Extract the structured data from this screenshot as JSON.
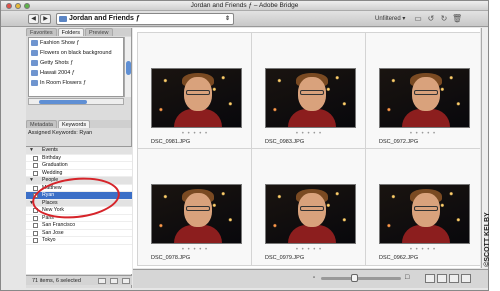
{
  "window": {
    "title": "Jordan and Friends ƒ – Adobe Bridge"
  },
  "toolbar": {
    "path": "Jordan and Friends ƒ",
    "filter": "Unfiltered",
    "back_icon": "back-arrow-icon",
    "forward_icon": "forward-arrow-icon"
  },
  "left_panel": {
    "top_tabs": [
      "Favorites",
      "Folders",
      "Preview"
    ],
    "folders": [
      "Fashion Show ƒ",
      "Flowers on black background",
      "Getty Shots ƒ",
      "Hawaii 2004 ƒ",
      "In Room Flowers ƒ"
    ],
    "bottom_tabs": [
      "Metadata",
      "Keywords"
    ],
    "assigned_keywords": "Assigned Keywords: Ryan",
    "keywords": [
      {
        "label": "Events",
        "type": "category"
      },
      {
        "label": "Birthday",
        "type": "item",
        "checked": false
      },
      {
        "label": "Graduation",
        "type": "item",
        "checked": false
      },
      {
        "label": "Wedding",
        "type": "item",
        "checked": false
      },
      {
        "label": "People",
        "type": "category"
      },
      {
        "label": "Matthew",
        "type": "item",
        "checked": false
      },
      {
        "label": "Ryan",
        "type": "item",
        "checked": true,
        "selected": true
      },
      {
        "label": "Places",
        "type": "category"
      },
      {
        "label": "New York",
        "type": "item",
        "checked": false
      },
      {
        "label": "Paris",
        "type": "item",
        "checked": false
      },
      {
        "label": "San Francisco",
        "type": "item",
        "checked": false
      },
      {
        "label": "San Jose",
        "type": "item",
        "checked": false
      },
      {
        "label": "Tokyo",
        "type": "item",
        "checked": false
      }
    ],
    "status": "71 items, 6 selected"
  },
  "content": {
    "thumbnails": [
      {
        "filename": "DSC_0981.JPG"
      },
      {
        "filename": "DSC_0983.JPG"
      },
      {
        "filename": "DSC_0972.JPG"
      },
      {
        "filename": "DSC_0978.JPG"
      },
      {
        "filename": "DSC_0979.JPG"
      },
      {
        "filename": "DSC_0962.JPG"
      }
    ],
    "rating_dots": "• • • • •"
  },
  "watermark": "©SCOTT KELBY",
  "colors": {
    "selection": "#3b6fc7",
    "highlight_circle": "#d6242a"
  }
}
